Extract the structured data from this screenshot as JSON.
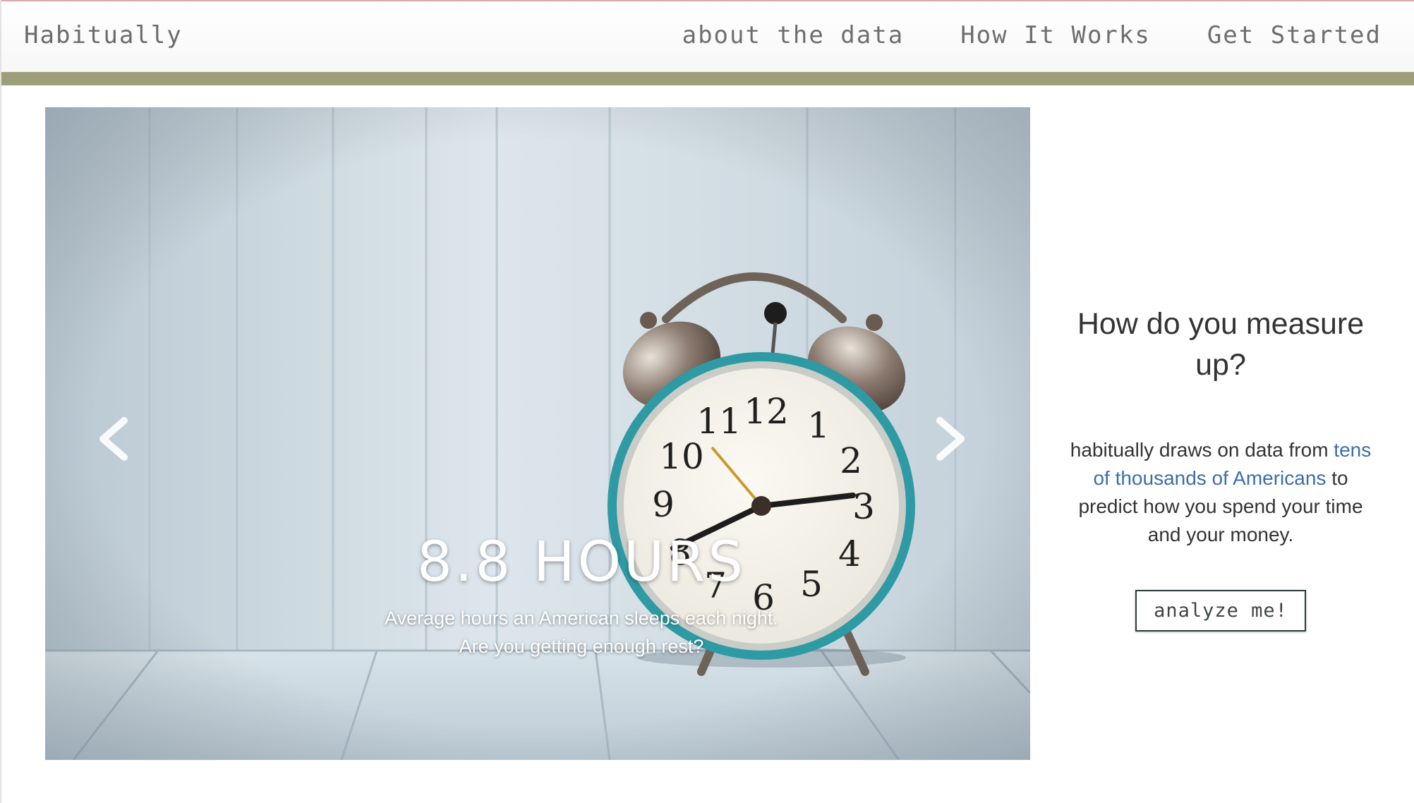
{
  "navbar": {
    "brand": "Habitually",
    "links": [
      {
        "label": "about the data"
      },
      {
        "label": "How It Works"
      },
      {
        "label": "Get Started"
      }
    ]
  },
  "colors": {
    "accent_bar": "#9e9f7a",
    "link": "#3a6ea8",
    "clock_ring": "#2e9aa4"
  },
  "carousel": {
    "slide_image": "alarm-clock-on-white-wood-photo",
    "caption_title": "8.8 HOURS",
    "caption_line1": "Average hours an American sleeps each night.",
    "caption_line2": "Are you getting enough rest?",
    "prev_icon": "chevron-left-icon",
    "next_icon": "chevron-right-icon",
    "slide_count": 5,
    "active_slide": 1
  },
  "side": {
    "heading": "How do you measure up?",
    "body_before": "habitually draws on data from ",
    "body_link": "tens of thousands of Americans",
    "body_after": " to predict how you spend your time and your money.",
    "button": "analyze me!"
  }
}
